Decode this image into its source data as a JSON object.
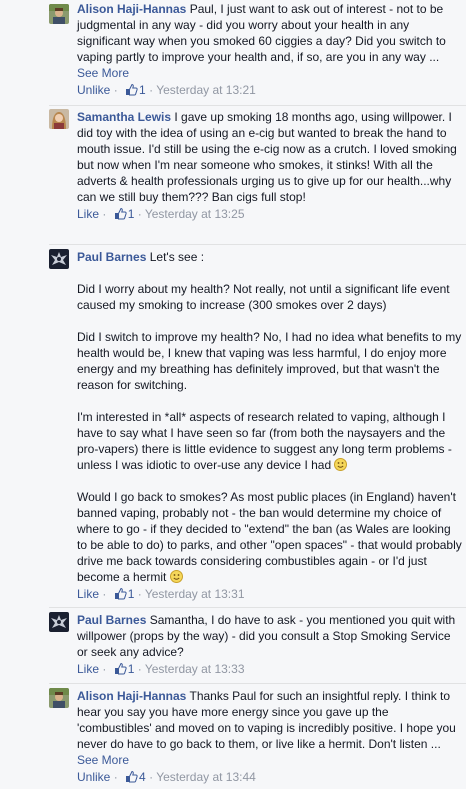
{
  "comments": [
    {
      "author": "Alison Haji-Hannas",
      "text": "Paul, I just want to ask out of interest - not to be judgmental in any way - did you worry about your health in any significant way when you smoked 60 ciggies a day? Did you switch to vaping partly to improve your health and, if so, are you in any way ...",
      "see_more": "See More",
      "action": "Unlike",
      "likes": "1",
      "time": "Yesterday at 13:21"
    },
    {
      "author": "Samantha Lewis",
      "text": "I gave up smoking 18 months ago, using willpower. I did toy with the idea of using an e-cig but wanted to break the hand to mouth issue. I'd still be using the e-cig now as a crutch. I loved smoking but now when I'm near someone who smokes, it stinks! With all the adverts & health professionals urging us to give up for our health...why can we still buy them??? Ban cigs full stop!",
      "action": "Like",
      "likes": "1",
      "time": "Yesterday at 13:25"
    },
    {
      "author": "Paul Barnes",
      "intro": "Let's see :",
      "paragraphs": [
        "Did I worry about my health? Not really, not until a significant life event caused my smoking to increase (300 smokes over 2 days)",
        "Did I switch to improve my health? No, I had no idea what benefits to my health would be, I knew that vaping was less harmful, I do enjoy more energy and my breathing has definitely improved, but that wasn't the reason for switching.",
        "I'm interested in *all* aspects of research related to vaping, although I have to say what I have seen so far (from both the naysayers and the pro-vapers) there is little evidence to suggest any long term problems - unless I was idiotic to over-use any device I had",
        "Would I go back to smokes? As most public places (in England) haven't banned vaping, probably not - the ban would determine my choice of where to go - if they decided to \"extend\" the ban (as Wales are looking to be able to do) to parks, and other \"open spaces\" - that would probably drive me back towards considering combustibles again - or I'd just become a hermit"
      ],
      "action": "Like",
      "likes": "1",
      "time": "Yesterday at 13:31"
    },
    {
      "author": "Paul Barnes",
      "text": "Samantha, I do have to ask - you mentioned you quit with willpower (props by the way) - did you consult a Stop Smoking Service or seek any advice?",
      "action": "Like",
      "likes": "1",
      "time": "Yesterday at 13:33"
    },
    {
      "author": "Alison Haji-Hannas",
      "text": "Thanks Paul for such an insightful reply. I think to hear you say you have more energy since you gave up the 'combustibles' and moved on to vaping is incredibly positive. I hope you never do have to go back to them, or live like a hermit. Don't listen ...",
      "see_more": "See More",
      "action": "Unlike",
      "likes": "4",
      "time": "Yesterday at 13:44"
    }
  ],
  "separator": "·",
  "colors": {
    "link": "#3b5998",
    "meta": "#9197a3",
    "background": "#f6f7f9"
  },
  "icons": {
    "like": "thumbs-up-icon",
    "smiley": "smiley-emoticon"
  }
}
